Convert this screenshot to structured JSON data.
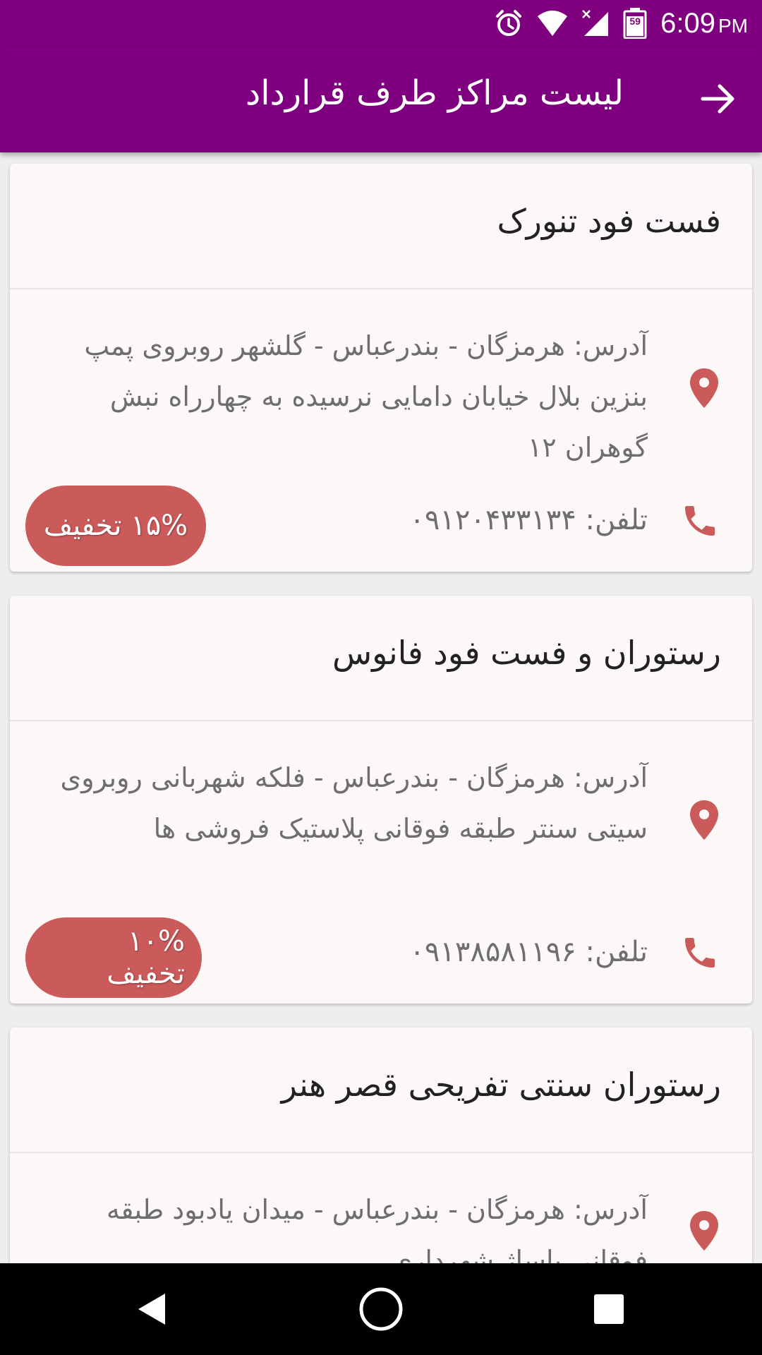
{
  "status_bar": {
    "time": "6:09",
    "ampm": "PM",
    "battery_level": "59",
    "icons": [
      "alarm-icon",
      "wifi-icon",
      "signal-icon",
      "battery-icon"
    ]
  },
  "app_bar": {
    "title": "لیست مراکز طرف قرارداد",
    "back_icon": "arrow-right-icon"
  },
  "colors": {
    "primary": "#7e007e",
    "accent": "#cb5a5a",
    "card_bg": "#fcf8f8",
    "text_secondary": "#6e6e6e"
  },
  "centers": [
    {
      "name": "فست فود تنورک",
      "address": "آدرس: هرمزگان - بندرعباس - گلشهر روبروی پمپ بنزین بلال خیابان دامایی نرسیده به چهارراه نبش گوهران ۱۲",
      "phone": "تلفن: ۰۹۱۲۰۴۳۳۱۳۴",
      "discount": "۱۵% تخفیف"
    },
    {
      "name": "رستوران و فست فود فانوس",
      "address": "آدرس: هرمزگان - بندرعباس - فلکه شهربانی روبروی سیتی سنتر طبقه فوقانی پلاستیک فروشی ها",
      "phone": "تلفن: ۰۹۱۳۸۵۸۱۱۹۶",
      "discount": "۱۰% تخفیف"
    },
    {
      "name": "رستوران سنتی تفریحی قصر هنر",
      "address": "آدرس: هرمزگان - بندرعباس - میدان یادبود طبقه فوقانی پاساژ شهرداری"
    }
  ],
  "nav_bar": {
    "icons": [
      "back-triangle-icon",
      "home-circle-icon",
      "recents-square-icon"
    ]
  }
}
